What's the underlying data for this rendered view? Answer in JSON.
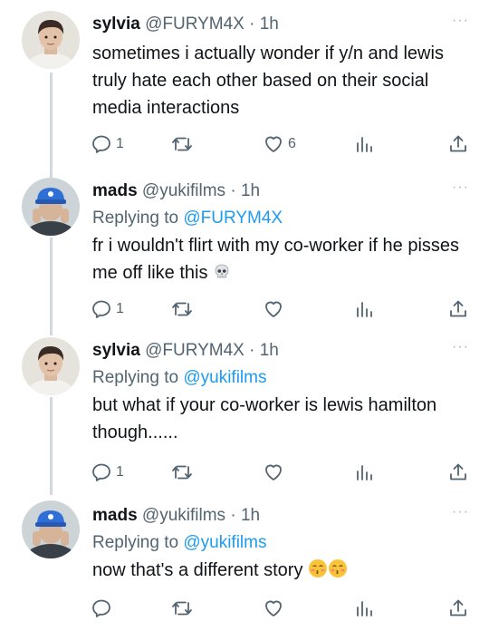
{
  "tweets": [
    {
      "name": "sylvia",
      "handle": "@FURYM4X",
      "dot": "·",
      "time": "1h",
      "more": "···",
      "replying_prefix": "",
      "replying_to": "",
      "text": "sometimes i actually wonder if y/n and lewis truly hate each other based on their social media interactions",
      "emoji": "",
      "counts": {
        "reply": "1",
        "retweet": "",
        "like": "6"
      },
      "avatar_icon": "person-avatar-icon"
    },
    {
      "name": "mads",
      "handle": "@yukifilms",
      "dot": "·",
      "time": "1h",
      "more": "···",
      "replying_prefix": "Replying to ",
      "replying_to": "@FURYM4X",
      "text": "fr i wouldn't flirt with my co-worker if he pisses me off like this",
      "emoji": "skull-emoji",
      "counts": {
        "reply": "1",
        "retweet": "",
        "like": ""
      },
      "avatar_icon": "blue-cap-avatar-icon"
    },
    {
      "name": "sylvia",
      "handle": "@FURYM4X",
      "dot": "·",
      "time": "1h",
      "more": "···",
      "replying_prefix": "Replying to ",
      "replying_to": "@yukifilms",
      "text": "but what if your co-worker is lewis hamilton though......",
      "emoji": "",
      "counts": {
        "reply": "1",
        "retweet": "",
        "like": ""
      },
      "avatar_icon": "person-avatar-icon"
    },
    {
      "name": "mads",
      "handle": "@yukifilms",
      "dot": "·",
      "time": "1h",
      "more": "···",
      "replying_prefix": "Replying to ",
      "replying_to": "@yukifilms",
      "text": "now that's a different story",
      "emoji": "kissing-face-emoji",
      "counts": {
        "reply": "",
        "retweet": "",
        "like": ""
      },
      "avatar_icon": "blue-cap-avatar-icon"
    }
  ],
  "colors": {
    "link": "#1d9bf0",
    "secondary": "#536471",
    "thread_line": "#cfd9de"
  }
}
